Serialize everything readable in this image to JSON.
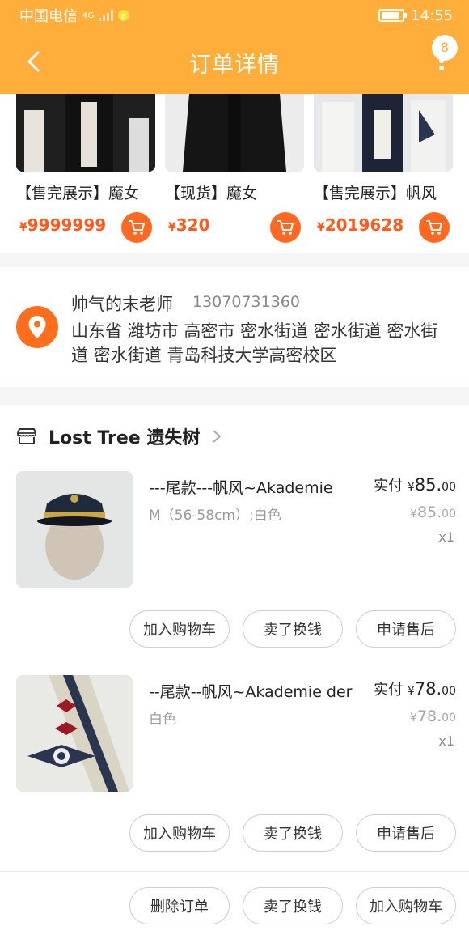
{
  "status": {
    "carrier": "中国电信",
    "net": "4G",
    "time": "14:55",
    "battery_level": 0.85
  },
  "header": {
    "title": "订单详情",
    "badge": "8"
  },
  "recommend": [
    {
      "name": "【售完展示】魔女",
      "currency": "¥",
      "price": "9999999"
    },
    {
      "name": "【现货】魔女",
      "currency": "¥",
      "price": "320"
    },
    {
      "name": "【售完展示】帆风",
      "currency": "¥",
      "price": "2019628"
    }
  ],
  "address": {
    "name": "帅气的末老师",
    "phone": "13070731360",
    "detail": "山东省 潍坊市 高密市 密水街道 密水街道 密水街道 密水街道 青岛科技大学高密校区"
  },
  "shop": {
    "name": "Lost Tree 遗失树"
  },
  "items": [
    {
      "title": "---尾款---帆风~Akademie",
      "spec": "M（56-58cm）;白色",
      "paid_label": "实付",
      "currency": "¥",
      "paid_int": "85.",
      "paid_dec": "00",
      "orig_int": "85.",
      "orig_dec": "00",
      "qty": "x1",
      "buttons": [
        "加入购物车",
        "卖了换钱",
        "申请售后"
      ]
    },
    {
      "title": "--尾款--帆风~Akademie der",
      "spec": "白色",
      "paid_label": "实付",
      "currency": "¥",
      "paid_int": "78.",
      "paid_dec": "00",
      "orig_int": "78.",
      "orig_dec": "00",
      "qty": "x1",
      "buttons": [
        "加入购物车",
        "卖了换钱",
        "申请售后"
      ]
    }
  ],
  "bottom_actions": [
    "删除订单",
    "卖了换钱",
    "加入购物车"
  ],
  "colors": {
    "header": "#ffad3b",
    "accent": "#ff5a1a"
  }
}
